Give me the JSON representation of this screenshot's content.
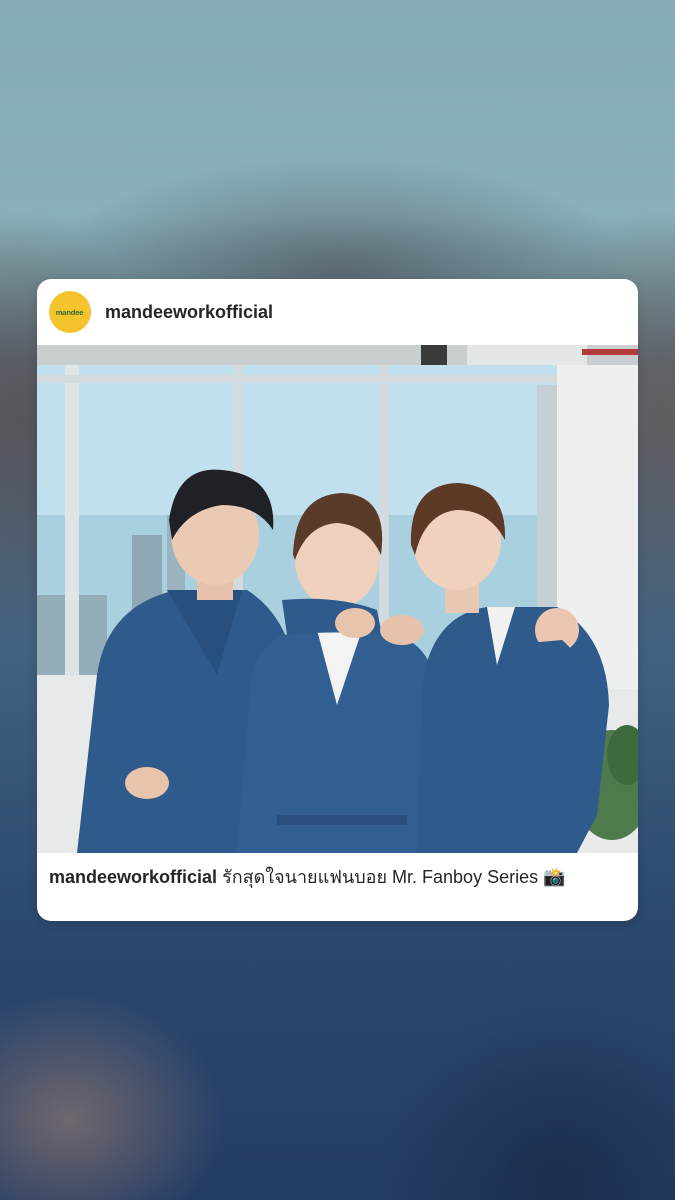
{
  "post": {
    "username": "mandeeworkofficial",
    "avatar_text": "mandee",
    "avatar_color": "#f5c32c",
    "caption_user": "mandeeworkofficial",
    "caption_text": "รักสุดใจนายแฟนบอย Mr. Fanboy Series",
    "caption_emoji": "📸"
  },
  "icons": [
    "brand-logo-icon",
    "camera-flash-emoji"
  ],
  "colors": {
    "card": "#ffffff",
    "text": "#262626",
    "robe": "#2f5b8c",
    "background": "#3f5f80"
  }
}
